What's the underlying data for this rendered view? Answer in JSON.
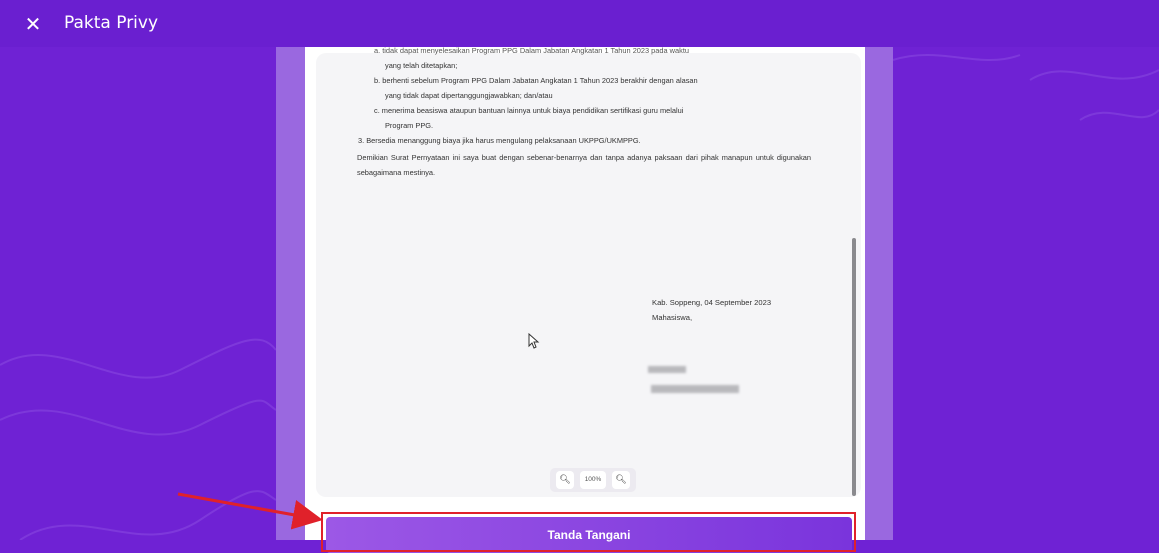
{
  "window": {
    "title": "Pakta Privy",
    "close_icon": "close-icon",
    "close_glyph": "✕"
  },
  "document": {
    "cut_line": "a. tidak dapat menyelesaikan Program PPG Dalam Jabatan Angkatan 1 Tahun 2023 pada waktu",
    "item_a_cont": "yang telah ditetapkan;",
    "item_b": "b. berhenti sebelum Program PPG Dalam Jabatan Angkatan 1 Tahun 2023 berakhir dengan alasan",
    "item_b_cont": "yang tidak dapat dipertanggungjawabkan; dan/atau",
    "item_c": "c. menerima beasiswa ataupun bantuan lainnya untuk biaya pendidikan sertifikasi guru melalui",
    "item_c_cont": "Program PPG.",
    "item_3": "3. Bersedia menanggung biaya jika harus mengulang pelaksanaan UKPPG/UKMPPG.",
    "closing": "Demikian Surat Pernyataan ini saya buat dengan sebenar-benarnya dan tanpa adanya paksaan dari pihak manapun untuk digunakan sebagaimana mestinya.",
    "place_date": "Kab. Soppeng, 04 September 2023",
    "role": "Mahasiswa,"
  },
  "zoom": {
    "value": "100%",
    "zoom_out_icon": "zoom-out-icon",
    "zoom_in_icon": "zoom-in-icon"
  },
  "actions": {
    "sign_label": "Tanda Tangani"
  },
  "colors": {
    "background": "#6f22d4",
    "topbar": "#6a1fd0",
    "button_start": "#9c58e6",
    "button_end": "#7a34dc",
    "annotation": "#e0212a"
  }
}
